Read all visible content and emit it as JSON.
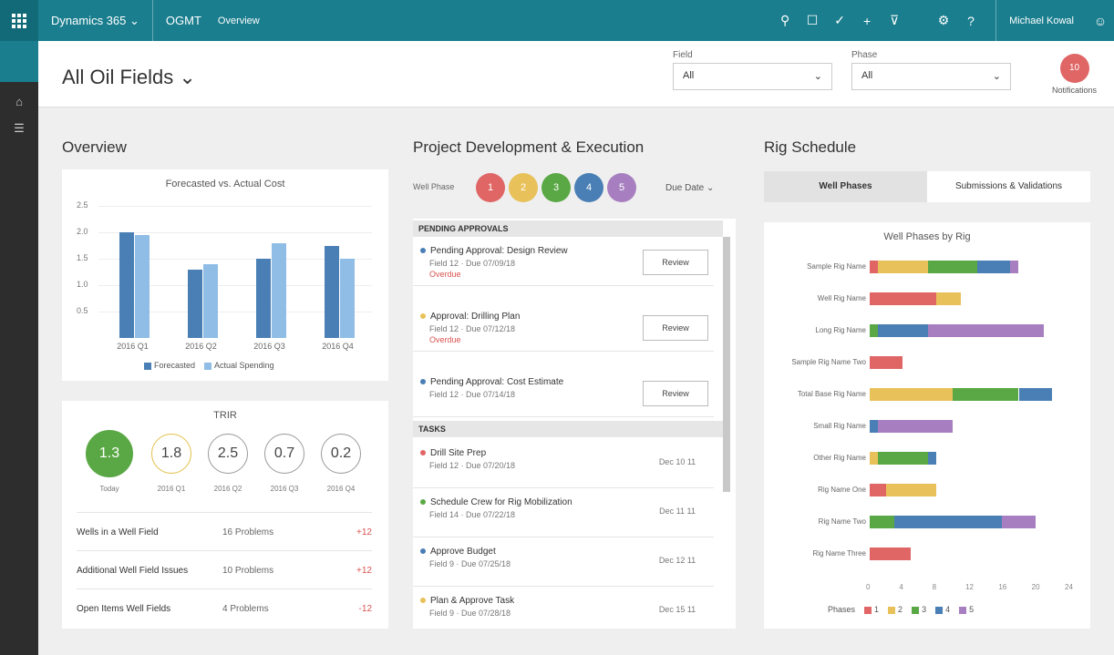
{
  "topbar": {
    "app": "Dynamics 365",
    "module": "OGMT",
    "area": "Overview",
    "user": "Michael Kowal",
    "icons": [
      "search-icon",
      "lightbulb-icon",
      "check-icon",
      "plus-icon",
      "filter-icon",
      "gear-icon",
      "help-icon"
    ]
  },
  "header": {
    "title": "All Oil Fields",
    "filter1_label": "Field",
    "filter1_value": "All",
    "filter2_label": "Phase",
    "filter2_value": "All",
    "notif_count": "10",
    "notif_label": "Notifications"
  },
  "overview": {
    "title": "Overview",
    "chart_title": "Forecasted vs. Actual Cost",
    "legend": [
      "Forecasted",
      "Actual Spending"
    ]
  },
  "kpis": {
    "title": "TRIR",
    "rings": [
      {
        "value": "1.3",
        "label": "Today"
      },
      {
        "value": "1.8",
        "label": "2016 Q1"
      },
      {
        "value": "2.5",
        "label": "2016 Q2"
      },
      {
        "value": "0.7",
        "label": "2016 Q3"
      },
      {
        "value": "0.2",
        "label": "2016 Q4"
      }
    ],
    "rows": [
      {
        "name": "Wells in a Well Field",
        "value": "16 Problems",
        "delta": "+12"
      },
      {
        "name": "Additional Well Field Issues",
        "value": "10 Problems",
        "delta": "+12"
      },
      {
        "name": "Open Items Well Fields",
        "value": "4 Problems",
        "delta": "-12"
      }
    ]
  },
  "pde": {
    "title": "Project Development & Execution",
    "well_phases_label": "Well Phase",
    "phases": [
      "1",
      "2",
      "3",
      "4",
      "5"
    ],
    "sort_label": "Due Date",
    "group1": "PENDING APPROVALS",
    "group2": "TASKS",
    "approvals": [
      {
        "title": "Pending Approval: Design Review",
        "sub": "Field 12 · Due 07/09/18",
        "status": "Overdue",
        "btn": "Review"
      },
      {
        "title": "Approval: Drilling Plan",
        "sub": "Field 12 · Due 07/12/18",
        "status": "Overdue",
        "btn": "Review"
      },
      {
        "title": "Pending Approval: Cost Estimate",
        "sub": "Field 12 · Due 07/14/18",
        "status": "",
        "btn": "Review"
      }
    ],
    "tasks": [
      {
        "title": "Drill Site Prep",
        "sub": "Field 12 · Due 07/20/18",
        "date": "Dec 10 11"
      },
      {
        "title": "Schedule Crew for Rig Mobilization",
        "sub": "Field 14 · Due 07/22/18",
        "date": "Dec 11 11"
      },
      {
        "title": "Approve Budget",
        "sub": "Field 9 · Due 07/25/18",
        "date": "Dec 12 11"
      },
      {
        "title": "Plan & Approve Task",
        "sub": "Field 9 · Due 07/28/18",
        "date": "Dec 15 11"
      }
    ]
  },
  "rig": {
    "title": "Rig Schedule",
    "tabs": [
      "Well Phases",
      "Submissions & Validations"
    ],
    "chart_title": "Well Phases by Rig",
    "legend_label": "Phases",
    "legend": [
      "1",
      "2",
      "3",
      "4",
      "5"
    ]
  },
  "colors": {
    "teal": "#1a7e8e",
    "forecast": "#4a7fb5",
    "actual": "#8fbde6",
    "p1": "#e06666",
    "p2": "#e8c15a",
    "p3": "#5aa845",
    "p4": "#4a7fb5",
    "p5": "#a77fc0"
  },
  "chart_data": [
    {
      "type": "bar",
      "title": "Forecasted vs. Actual Cost",
      "categories": [
        "2016 Q1",
        "2016 Q2",
        "2016 Q3",
        "2016 Q4"
      ],
      "series": [
        {
          "name": "Forecasted",
          "values": [
            2.0,
            1.3,
            1.5,
            1.75
          ]
        },
        {
          "name": "Actual Spending",
          "values": [
            1.95,
            1.4,
            1.8,
            1.5
          ]
        }
      ],
      "ylim": [
        0,
        2.5
      ],
      "yticks": [
        "2.5",
        "2.0",
        "1.5",
        "1.0",
        "0.5"
      ]
    },
    {
      "type": "bar",
      "orientation": "horizontal-stacked",
      "title": "Well Phases by Rig",
      "categories": [
        "Sample Rig Name",
        "Well Rig Name",
        "Long Rig Name",
        "Sample Rig Name Two",
        "Total Base Rig Name",
        "Small Rig Name",
        "Other Rig Name",
        "Rig Name One",
        "Rig Name Two",
        "Rig Name Three"
      ],
      "series": [
        {
          "name": "1",
          "values": [
            1,
            8,
            0,
            4,
            0,
            0,
            0,
            2,
            0,
            5
          ]
        },
        {
          "name": "2",
          "values": [
            6,
            3,
            0,
            0,
            10,
            0,
            1,
            6,
            0,
            0
          ]
        },
        {
          "name": "3",
          "values": [
            6,
            0,
            1,
            0,
            8,
            0,
            6,
            0,
            3,
            0
          ]
        },
        {
          "name": "4",
          "values": [
            4,
            0,
            6,
            0,
            4,
            1,
            1,
            0,
            13,
            0
          ]
        },
        {
          "name": "5",
          "values": [
            1,
            0,
            14,
            0,
            0,
            9,
            0,
            0,
            4,
            0
          ]
        }
      ],
      "xlim": [
        0,
        24
      ],
      "xticks": [
        "0",
        "4",
        "8",
        "12",
        "16",
        "20",
        "24"
      ]
    }
  ]
}
